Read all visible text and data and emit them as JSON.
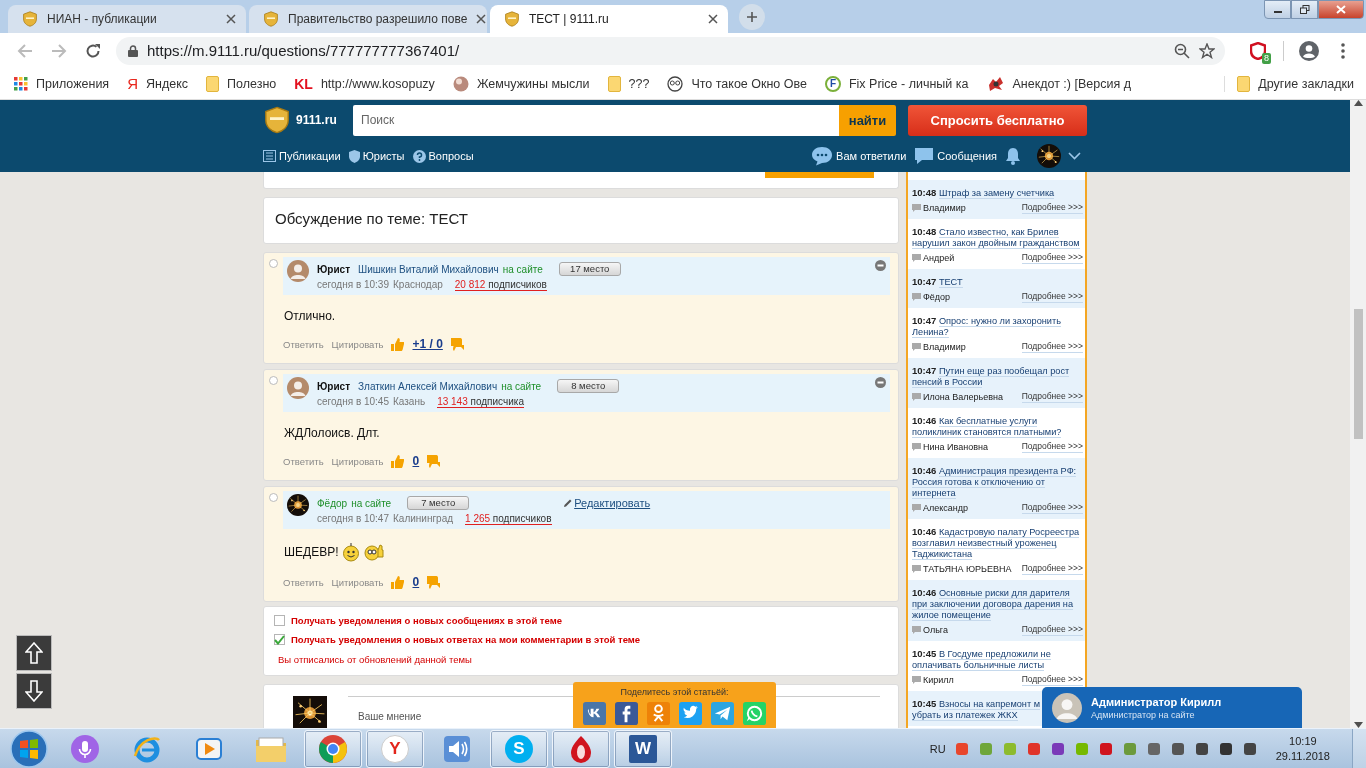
{
  "browser": {
    "tabs": [
      {
        "title": "НИАН - публикации",
        "selected": false
      },
      {
        "title": "Правительство разрешило пове",
        "selected": false
      },
      {
        "title": "ТЕСТ | 9111.ru",
        "selected": true
      }
    ],
    "url": "https://m.9111.ru/questions/777777777367401/",
    "extension_badge": "8",
    "bookmarks": [
      {
        "kind": "apps",
        "label": "Приложения"
      },
      {
        "kind": "yandex",
        "icon_text": "Я",
        "label": "Яндекс"
      },
      {
        "kind": "folder",
        "label": "Полезно"
      },
      {
        "kind": "kl",
        "icon_text": "KL",
        "label": "http://www.kosopuzy"
      },
      {
        "kind": "pearl",
        "label": "Жемчужины мысли"
      },
      {
        "kind": "folder",
        "label": "???"
      },
      {
        "kind": "glasses",
        "label": "Что такое Окно Ове"
      },
      {
        "kind": "fixprice",
        "icon_text": "F",
        "label": "Fix Price - личный ка"
      },
      {
        "kind": "splat",
        "label": "Анекдот :) [Версия д"
      }
    ],
    "other_bookmarks": "Другие закладки"
  },
  "site": {
    "name": "9111.ru",
    "search_placeholder": "Поиск",
    "search_button": "найти",
    "ask_button": "Спросить бесплатно",
    "nav": [
      {
        "kind": "publications",
        "label": "Публикации"
      },
      {
        "kind": "lawyers",
        "label": "Юристы"
      },
      {
        "kind": "questions",
        "label": "Вопросы"
      }
    ],
    "user_nav": [
      {
        "kind": "answers",
        "label": "Вам ответили"
      },
      {
        "kind": "messages",
        "label": "Сообщения"
      }
    ]
  },
  "discussion_title": "Обсуждение по теме: ТЕСТ",
  "comments": [
    {
      "role": "Юрист",
      "author": "Шишкин Виталий Михайлович",
      "online": "на сайте",
      "rank": "17 место",
      "date": "сегодня в 10:39",
      "city": "Краснодар",
      "subscribers": "20 812",
      "subscribers_word": "подписчиков",
      "text": "Отлично.",
      "actions": [
        "Ответить",
        "Цитировать"
      ],
      "score": "+1 / 0",
      "kind": "lawyer",
      "collapsible": true,
      "selected": false
    },
    {
      "role": "Юрист",
      "author": "Златкин Алексей Михайлович",
      "online": "на сайте",
      "rank": "8 место",
      "date": "сегодня в 10:45",
      "city": "Казань",
      "subscribers": "13 143",
      "subscribers_word": "подписчика",
      "text": "ЖДЛолоисв. Длт.",
      "actions": [
        "Ответить",
        "Цитировать"
      ],
      "score": "0",
      "kind": "lawyer",
      "collapsible": true,
      "selected": false
    },
    {
      "author": "Фёдор",
      "online": "на сайте",
      "rank": "7 место",
      "edit": "Редактировать",
      "date": "сегодня в 10:47",
      "city": "Калининград",
      "subscribers": "1 265",
      "subscribers_word": "подписчиков",
      "text": "ШЕДЕВР!",
      "emoticons": [
        {
          "kind": "smile"
        },
        {
          "kind": "thumbs"
        }
      ],
      "actions": [
        "Ответить",
        "Цитировать"
      ],
      "score": "0",
      "kind": "user",
      "collapsible": false,
      "selected": false
    }
  ],
  "subscriptions": [
    {
      "label": "Получать уведомления о новых сообщениях в этой теме",
      "checked": false
    },
    {
      "label": "Получать уведомления о новых ответах на мои комментарии в этой теме",
      "checked": true
    }
  ],
  "unsubscribed_note": "Вы отписались от обновлений данной темы",
  "reply": {
    "placeholder": "Ваше мнение"
  },
  "news": [
    {
      "time": "10:48",
      "title": "Штраф за замену счетчика",
      "author": "Владимир",
      "more": "Подробнее >>>"
    },
    {
      "time": "10:48",
      "title": "Стало известно, как Брилев нарушил закон двойным гражданством",
      "author": "Андрей",
      "more": "Подробнее >>>"
    },
    {
      "time": "10:47",
      "title": "ТЕСТ",
      "author": "Фёдор",
      "more": "Подробнее >>>"
    },
    {
      "time": "10:47",
      "title": "Опрос: нужно ли захоронить Ленина?",
      "author": "Владимир",
      "more": "Подробнее >>>"
    },
    {
      "time": "10:47",
      "title": "Путин еще раз пообещал рост пенсий в России",
      "author": "Илона Валерьевна",
      "more": "Подробнее >>>"
    },
    {
      "time": "10:46",
      "title": "Как бесплатные услуги поликлиник становятся платными?",
      "author": "Нина Ивановна",
      "more": "Подробнее >>>"
    },
    {
      "time": "10:46",
      "title": "Администрация президента РФ: Россия готова к отключению от интернета",
      "author": "Александр",
      "more": "Подробнее >>>"
    },
    {
      "time": "10:46",
      "title": "Кадастровую палату Росреестра возглавил неизвестный уроженец Таджикистана",
      "author": "ТАТЬЯНА ЮРЬЕВНА",
      "more": "Подробнее >>>"
    },
    {
      "time": "10:46",
      "title": "Основные риски для дарителя при заключении договора дарения на жилое помещение",
      "author": "Ольга",
      "more": "Подробнее >>>"
    },
    {
      "time": "10:45",
      "title": "В Госдуме предложили не оплачивать больничные листы",
      "author": "Кирилл",
      "more": "Подробнее >>>"
    },
    {
      "time": "10:45",
      "title_lines": [
        "Взносы на капремонт м",
        "убрать из платежек ЖКХ"
      ]
    }
  ],
  "share": {
    "title": "Поделитесь этой статьёй:",
    "networks": [
      {
        "kind": "vk"
      },
      {
        "kind": "facebook"
      },
      {
        "kind": "ok"
      },
      {
        "kind": "twitter"
      },
      {
        "kind": "telegram"
      },
      {
        "kind": "whatsapp"
      }
    ]
  },
  "chat_popup": {
    "name": "Администратор Кирилл",
    "status": "Администратор на сайте"
  },
  "taskbar": {
    "apps": [
      {
        "kind": "mic",
        "open": false
      },
      {
        "kind": "ie",
        "open": false
      },
      {
        "kind": "media",
        "open": false
      },
      {
        "kind": "explorer",
        "open": false
      },
      {
        "kind": "chrome",
        "open": true
      },
      {
        "kind": "letter",
        "icon_text": "Y",
        "open": true
      },
      {
        "kind": "speaker",
        "open": false
      },
      {
        "kind": "skype",
        "icon_text": "S",
        "open": true
      },
      {
        "kind": "drop",
        "open": true
      },
      {
        "kind": "word",
        "icon_text": "W",
        "open": true
      }
    ],
    "language": "RU",
    "time": "10:19",
    "date": "29.11.2018"
  }
}
